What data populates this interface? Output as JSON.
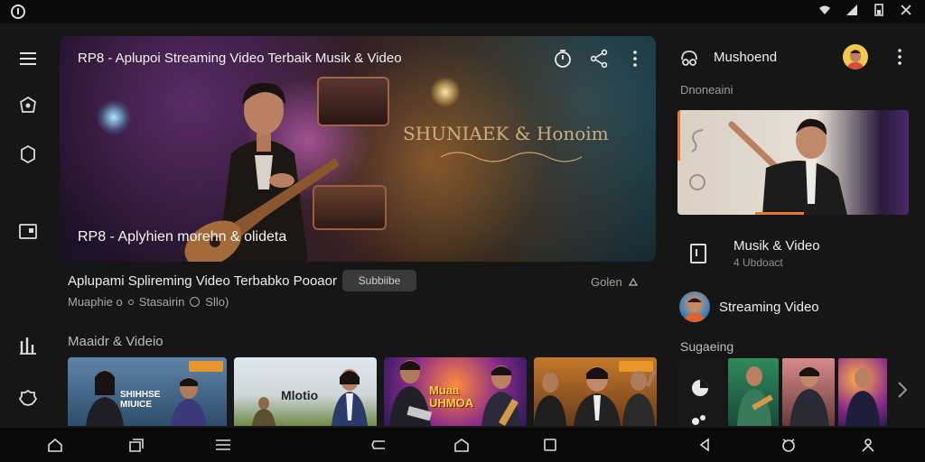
{
  "hero": {
    "title": "RP8 - Aplupoi Streaming Video Terbaik Musik & Video",
    "watermark": "SHUNIAEK & Honoim",
    "caption": "RP8 - Aplyhien morehn & olideta"
  },
  "video": {
    "title": "Aplupami Splireming Video Terbabko Pooaor",
    "chip_label": "Subbiibe",
    "meta_left": "Muaphie o",
    "meta_mid": "Stasairin",
    "meta_right": "Sllo)",
    "action_right": "Golen"
  },
  "section1": {
    "title": "Maaidr & Videio"
  },
  "thumbs": [
    {
      "text": "SHIHHSE MIUICE"
    },
    {
      "text": "Mlotio"
    },
    {
      "text": "Muaa UHMOA"
    },
    {
      "text": ""
    }
  ],
  "right_panel": {
    "title": "Mushoend",
    "subtitle": "Dnoneaini",
    "items": [
      {
        "label": "Musik & Video",
        "sub": "4 Ubdoact"
      },
      {
        "label": "Streaming Video",
        "sub": ""
      }
    ],
    "section2": "Sugaeing"
  },
  "colors": {
    "accent": "#e8782a",
    "background": "#161616",
    "statusbar": "#0b0b0b"
  },
  "icons": {
    "statusbar": [
      "wifi-icon",
      "signal-icon",
      "battery-icon",
      "close-x-icon"
    ],
    "rail": [
      "menu-icon",
      "explore-icon",
      "refresh-icon",
      "library-icon",
      "stats-icon",
      "settings-icon"
    ],
    "hero_actions": [
      "timer-icon",
      "share-icon",
      "more-vert-icon"
    ],
    "navbar": [
      "home-icon",
      "window-icon",
      "list-icon",
      "back-swipe-icon",
      "home-outline-icon",
      "recents-icon",
      "back-arrow-icon",
      "screenshot-icon",
      "user-icon"
    ]
  }
}
